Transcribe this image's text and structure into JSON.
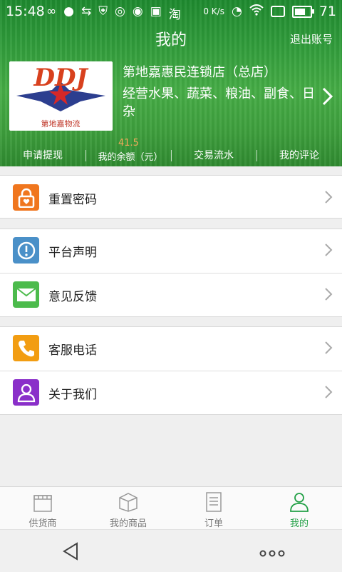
{
  "status_bar": {
    "time": "15:48",
    "signal": "0 K/s",
    "battery": "71"
  },
  "header": {
    "title": "我的",
    "logout_label": "退出账号",
    "logo": {
      "text": "DDJ",
      "subtext": "第地嘉物流"
    },
    "store_name": "第地嘉惠民连锁店（总店）",
    "store_desc": "经营水果、蔬菜、粮油、副食、日杂",
    "stats": [
      {
        "label": "申请提现"
      },
      {
        "label": "我的余额（元）",
        "value": "41.5"
      },
      {
        "label": "交易流水"
      },
      {
        "label": "我的评论"
      }
    ]
  },
  "menu": {
    "reset_password": "重置密码",
    "platform_statement": "平台声明",
    "feedback": "意见反馈",
    "customer_service": "客服电话",
    "about_us": "关于我们"
  },
  "tabs": [
    {
      "label": "供货商",
      "icon": "store-icon"
    },
    {
      "label": "我的商品",
      "icon": "box-icon"
    },
    {
      "label": "订单",
      "icon": "document-icon"
    },
    {
      "label": "我的",
      "icon": "person-icon",
      "active": true
    }
  ],
  "colors": {
    "header_green": "#2f9b3a",
    "accent_green": "#22a046",
    "balance_orange": "#f0a85a",
    "icon_orange": "#f0761e",
    "icon_blue": "#4a90c8",
    "icon_green": "#4cbb4c",
    "icon_amber": "#f29d12",
    "icon_purple": "#8a2fc9"
  }
}
